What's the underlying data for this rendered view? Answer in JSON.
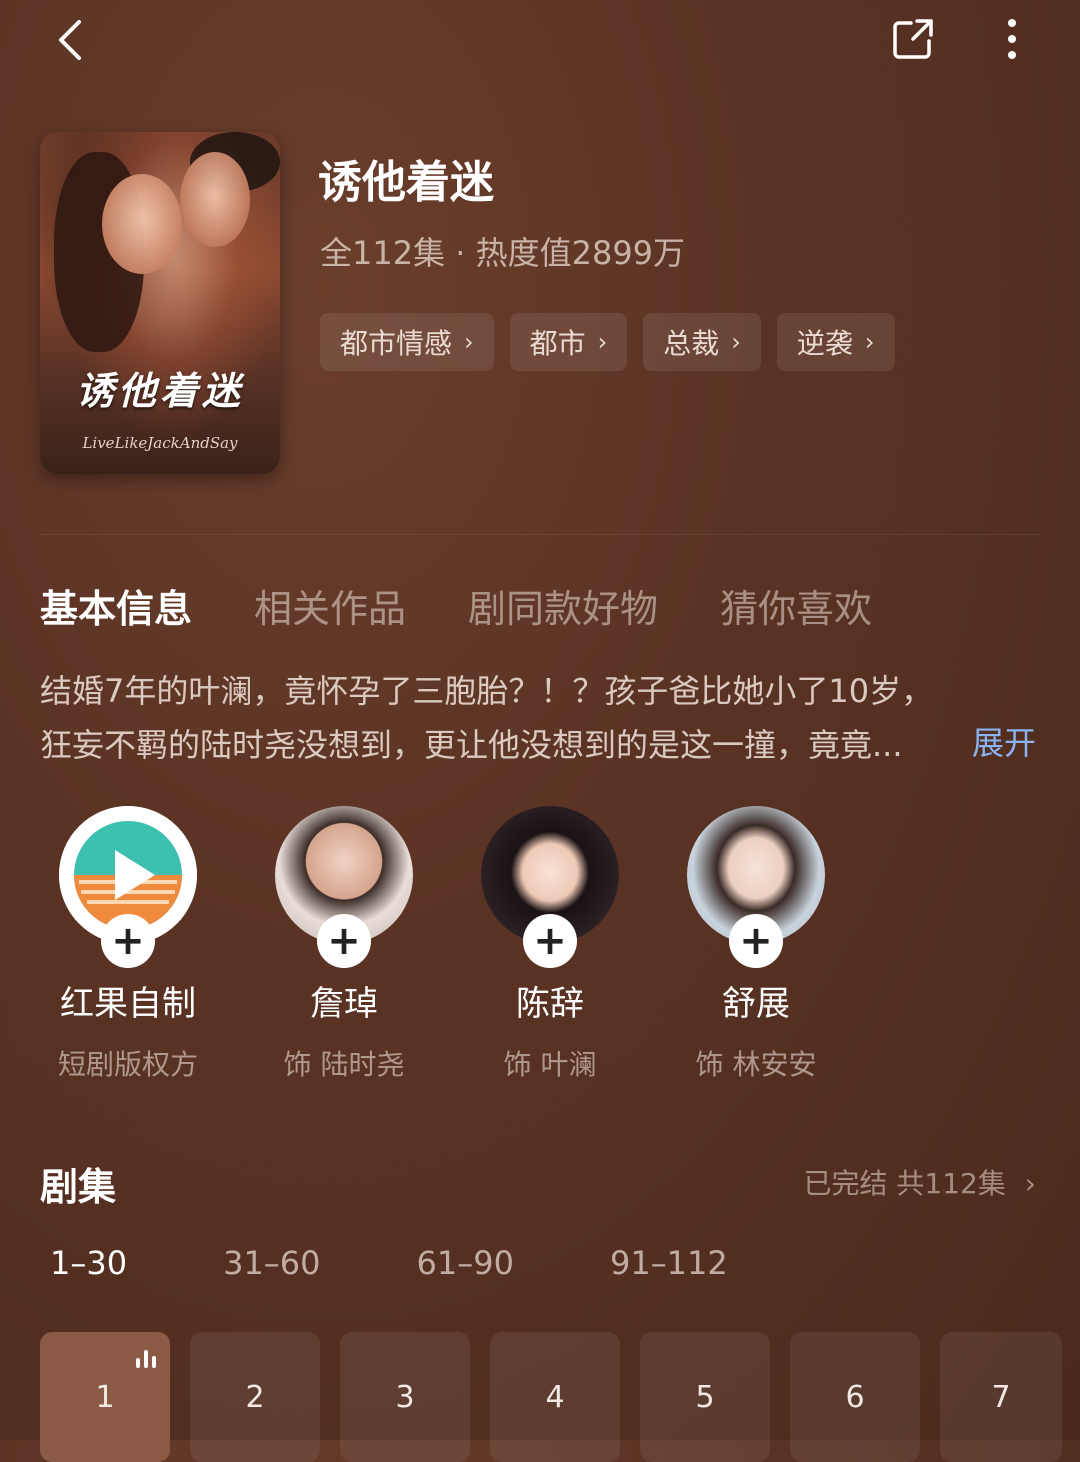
{
  "drama": {
    "title": "诱他着迷",
    "meta": "全112集 · 热度值2899万",
    "poster_title": "诱他着迷",
    "poster_sign": "LiveLikeJackAndSay",
    "tags": [
      "都市情感",
      "都市",
      "总裁",
      "逆袭"
    ]
  },
  "tabs": [
    "基本信息",
    "相关作品",
    "剧同款好物",
    "猜你喜欢"
  ],
  "description": "结婚7年的叶澜，竟怀孕了三胞胎？！？孩子爸比她小了10岁，狂妄不羁的陆时尧没想到，更让他没想到的是这一撞，竟竟...",
  "expand_label": "展开",
  "cast": [
    {
      "name": "红果自制",
      "role": "短剧版权方"
    },
    {
      "name": "詹琸",
      "role": "饰 陆时尧"
    },
    {
      "name": "陈辞",
      "role": "饰 叶澜"
    },
    {
      "name": "舒展",
      "role": "饰 林安安"
    }
  ],
  "episodes": {
    "heading": "剧集",
    "status": "已完结 共112集",
    "ranges": [
      "1–30",
      "31–60",
      "61–90",
      "91–112"
    ],
    "items": [
      "1",
      "2",
      "3",
      "4",
      "5",
      "6",
      "7"
    ]
  },
  "colors": {
    "accent_link": "#8ab3f2",
    "active_episode": "#8a5a44"
  }
}
